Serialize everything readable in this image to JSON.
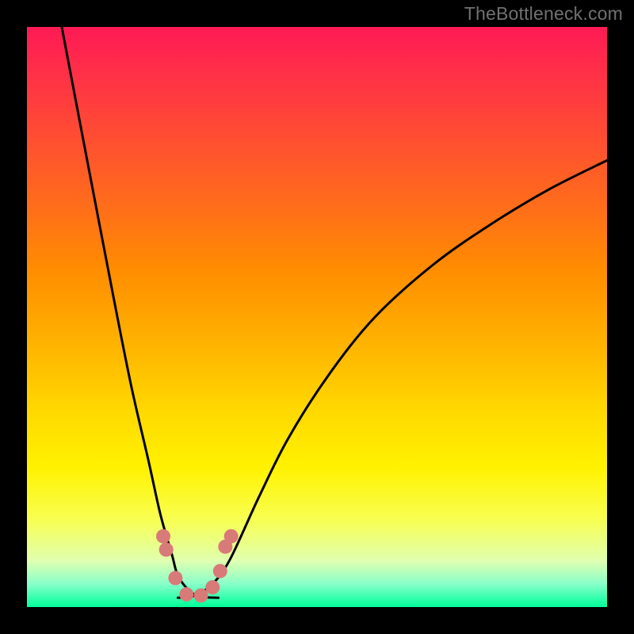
{
  "watermark": "TheBottleneck.com",
  "colors": {
    "background_black": "#000000",
    "gradient_top": "#ff1a55",
    "gradient_bottom": "#00ff99",
    "curve_stroke": "#000000",
    "marker_fill": "#d87a78",
    "watermark_text": "#717171"
  },
  "chart_data": {
    "type": "line",
    "title": "",
    "xlabel": "",
    "ylabel": "",
    "xlim": [
      0,
      1
    ],
    "ylim": [
      0,
      1
    ],
    "note": "Axes are unlabeled and unitless; x/y are normalized fractions of the plot area (y=1 at top, y=0 at bottom). Two curves form a V/funnel with minimum near x≈0.28.",
    "series": [
      {
        "name": "left-curve",
        "x": [
          0.06,
          0.1,
          0.15,
          0.18,
          0.21,
          0.23,
          0.25,
          0.26,
          0.28,
          0.3,
          0.33
        ],
        "values": [
          1.0,
          0.79,
          0.53,
          0.38,
          0.25,
          0.16,
          0.09,
          0.055,
          0.028,
          0.018,
          0.016
        ]
      },
      {
        "name": "right-curve",
        "x": [
          0.26,
          0.29,
          0.32,
          0.35,
          0.4,
          0.45,
          0.52,
          0.6,
          0.7,
          0.8,
          0.9,
          1.0
        ],
        "values": [
          0.016,
          0.02,
          0.04,
          0.082,
          0.19,
          0.29,
          0.4,
          0.5,
          0.59,
          0.66,
          0.72,
          0.77
        ]
      }
    ],
    "markers": {
      "name": "markers",
      "shape": "circle",
      "radius_px": 9,
      "x": [
        0.235,
        0.24,
        0.256,
        0.275,
        0.3,
        0.32,
        0.333,
        0.342,
        0.352
      ],
      "values": [
        0.122,
        0.099,
        0.05,
        0.022,
        0.02,
        0.034,
        0.062,
        0.104,
        0.122
      ]
    }
  }
}
